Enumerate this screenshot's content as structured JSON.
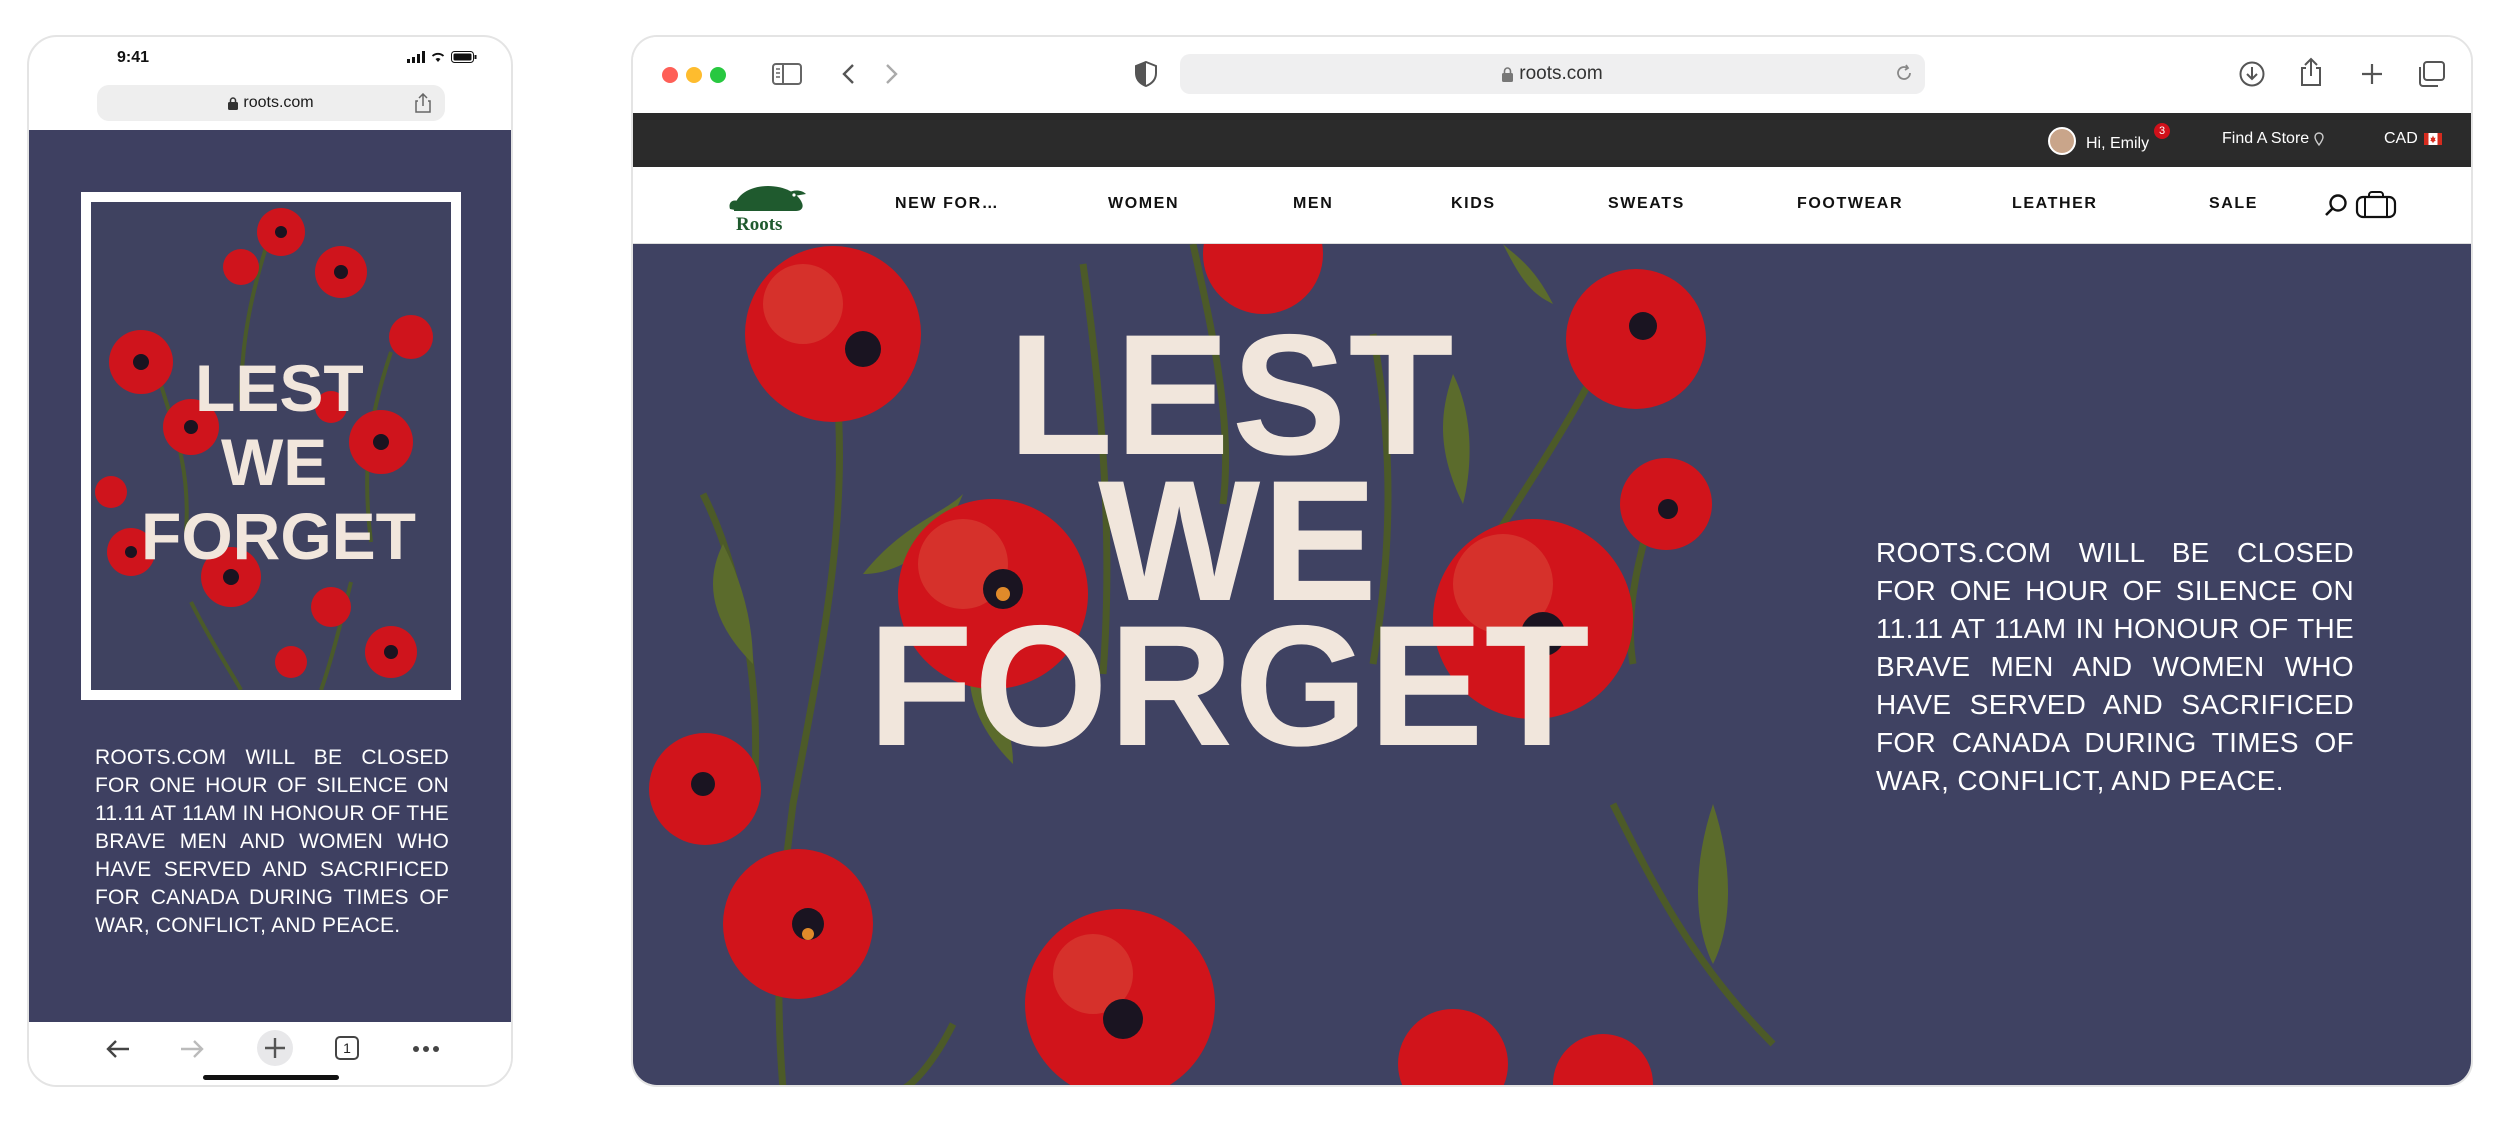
{
  "phone": {
    "status_time": "9:41",
    "url": "roots.com",
    "poster": {
      "line1": "LEST",
      "line2": "WE",
      "line3": "FORGET"
    },
    "notice": "ROOTS.COM WILL BE CLOSED FOR ONE HOUR OF SILENCE ON 11.11 AT 11AM IN HONOUR OF THE BRAVE MEN AND WOMEN WHO HAVE SERVED AND SACRIFICED FOR CANADA DURING TIMES OF WAR, CONFLICT, AND PEACE.",
    "toolbar": {
      "tabs_count": "1"
    }
  },
  "browser": {
    "url": "roots.com",
    "utility_bar": {
      "greeting": "Hi, Emily",
      "notification_count": "3",
      "find_store": "Find A Store",
      "currency": "CAD"
    },
    "nav": {
      "logo_text": "Roots",
      "items": [
        "NEW FOR…",
        "WOMEN",
        "MEN",
        "KIDS",
        "SWEATS",
        "FOOTWEAR",
        "LEATHER",
        "SALE"
      ]
    },
    "hero": {
      "line1": "LEST",
      "line2": "WE",
      "line3": "FORGET",
      "notice": "ROOTS.COM WILL BE CLOSED FOR ONE HOUR OF SILENCE ON 11.11 AT 11AM IN HONOUR OF THE BRAVE MEN AND WOMEN WHO HAVE SERVED AND SACRIFICED FOR CANADA DURING TIMES OF WAR, CONFLICT, AND PEACE."
    }
  },
  "colors": {
    "hero_bg": "#3f4262",
    "poppy_red": "#d4161c",
    "letters": "#f1e6dc",
    "utility_bar": "#2b2b2b",
    "logo_green": "#1f5a2e"
  }
}
